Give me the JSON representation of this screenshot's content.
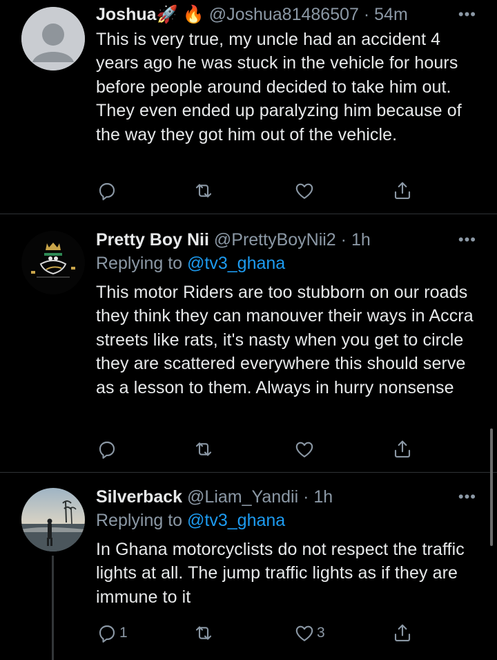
{
  "tweets": [
    {
      "name": "Joshua🚀 🔥",
      "handle": "@Joshua81486507",
      "dot": "·",
      "time": "54m",
      "more": "•••",
      "replying_prefix": "",
      "replying_mention": "",
      "text": "This is very true, my uncle had an accident 4 years ago he was stuck in the vehicle for hours before people around decided to take him out. They even ended up paralyzing him because of the way they got him out of the vehicle.",
      "reply_count": "",
      "retweet_count": "",
      "like_count": ""
    },
    {
      "name": "Pretty Boy Nii",
      "handle": "@PrettyBoyNii2",
      "dot": "·",
      "time": "1h",
      "more": "•••",
      "replying_prefix": "Replying to ",
      "replying_mention": "@tv3_ghana",
      "text": "This motor Riders are too stubborn on our roads they think they can manouver their ways in Accra streets like rats, it's nasty when you get to circle they are scattered everywhere this should serve as a lesson to them. Always in hurry nonsense",
      "reply_count": "",
      "retweet_count": "",
      "like_count": ""
    },
    {
      "name": "Silverback",
      "handle": "@Liam_Yandii",
      "dot": "·",
      "time": "1h",
      "more": "•••",
      "replying_prefix": "Replying to ",
      "replying_mention": "@tv3_ghana",
      "text": "In Ghana motorcyclists do not respect the traffic lights at all. The jump traffic lights as if they are immune to it",
      "reply_count": "1",
      "retweet_count": "",
      "like_count": "3"
    }
  ],
  "icons": [
    "reply-icon",
    "retweet-icon",
    "like-icon",
    "share-icon",
    "more-icon"
  ],
  "colors": {
    "background": "#000000",
    "text": "#e7e9ea",
    "secondary": "#8b98a5",
    "link": "#1d9bf0",
    "divider": "#2f3336"
  }
}
